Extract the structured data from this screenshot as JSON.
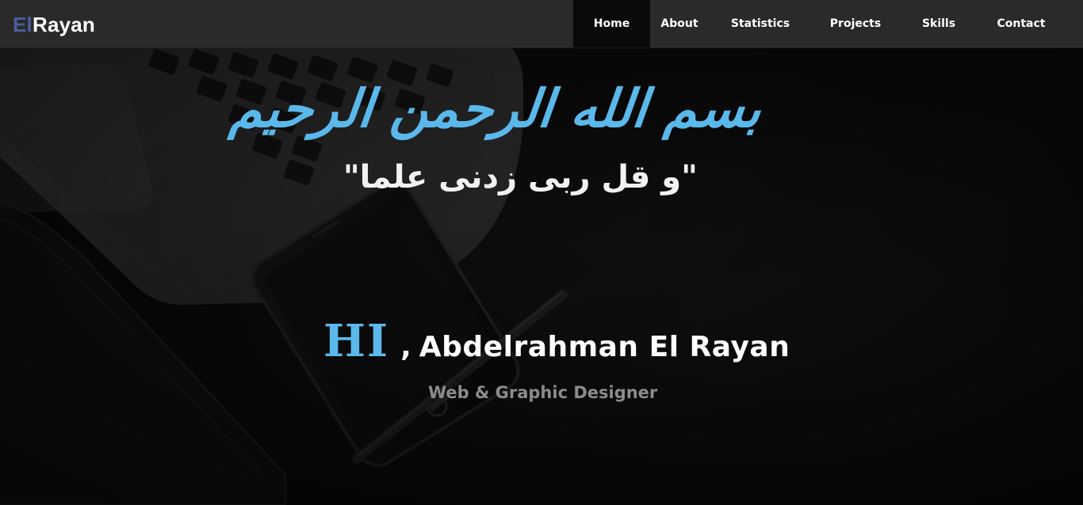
{
  "navbar": {
    "brand_prefix": "El",
    "brand_name": "Rayan",
    "items": [
      {
        "label": "Home",
        "active": true
      },
      {
        "label": "About",
        "active": false
      },
      {
        "label": "Statistics",
        "active": false
      },
      {
        "label": "Projects",
        "active": false
      },
      {
        "label": "Skills",
        "active": false
      },
      {
        "label": "Contact",
        "active": false
      }
    ]
  },
  "hero": {
    "arabic_title": "بسم الله الرحمن الرحيم",
    "arabic_subtitle": "\"و قل ربى زدنى علما\"",
    "greeting_hi": "HI",
    "greeting_comma": ",",
    "name": "Abdelrahman El Rayan",
    "role": "Web & Graphic Designer"
  },
  "colors": {
    "accent": "#5ab8ea",
    "brand_prefix": "#4a5fa0",
    "navbar_bg": "#2a2a2a",
    "nav_active_bg": "#0a0a0a",
    "role_text": "#8c8c8c"
  },
  "background": {
    "depicts": [
      "laptop",
      "smartphone",
      "pen",
      "leather-notebook"
    ]
  }
}
